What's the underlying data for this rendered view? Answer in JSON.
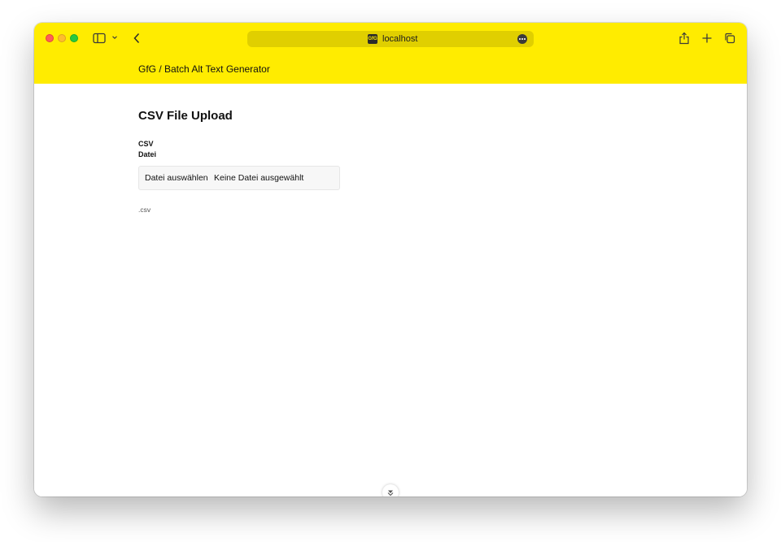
{
  "browser": {
    "url": "localhost",
    "favicon_text": "GfG",
    "colors": {
      "titlebar": "#ffec00",
      "urlbar": "#e0cf00"
    },
    "icons": {
      "sidebar": "sidebar-icon",
      "chevron": "chevron-down-icon",
      "back": "back-icon",
      "more": "more-icon",
      "share": "share-icon",
      "new_tab": "plus-icon",
      "tabs": "tabs-icon"
    }
  },
  "header": {
    "brand": "GfG / Batch Alt Text Generator"
  },
  "main": {
    "title": "CSV File Upload",
    "field_label_1": "CSV",
    "field_label_2": "Datei",
    "file_button_label": "Datei auswählen",
    "file_status": "Keine Datei ausgewählt",
    "hint": ".csv"
  }
}
